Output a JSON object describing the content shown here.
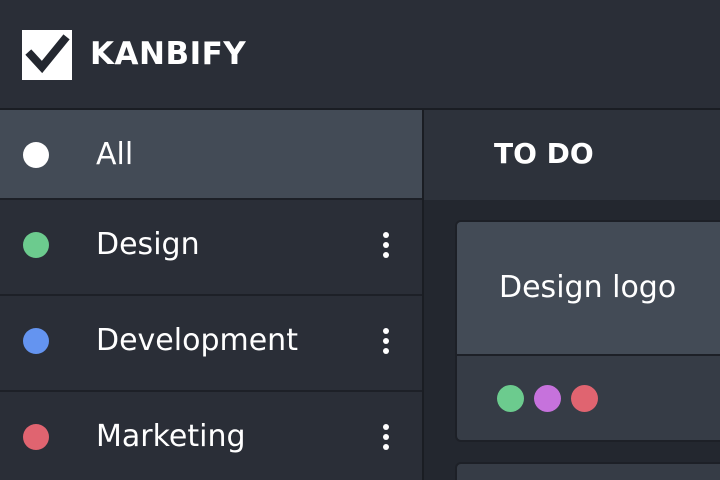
{
  "app": {
    "name": "KANBIFY"
  },
  "sidebar": {
    "items": [
      {
        "label": "All",
        "color": "#ffffff",
        "active": true,
        "has_menu": false
      },
      {
        "label": "Design",
        "color": "#6ccb8e",
        "active": false,
        "has_menu": true
      },
      {
        "label": "Development",
        "color": "#6494f0",
        "active": false,
        "has_menu": true
      },
      {
        "label": "Marketing",
        "color": "#e06470",
        "active": false,
        "has_menu": true
      }
    ]
  },
  "column": {
    "title": "TO DO",
    "cards": [
      {
        "title": "Design logo",
        "tag_colors": [
          "#6ccb8e",
          "#c672dc",
          "#e06470"
        ]
      }
    ]
  },
  "icons": {
    "logo": "checkbox-check-icon",
    "item_menu": "vertical-dots-icon"
  }
}
